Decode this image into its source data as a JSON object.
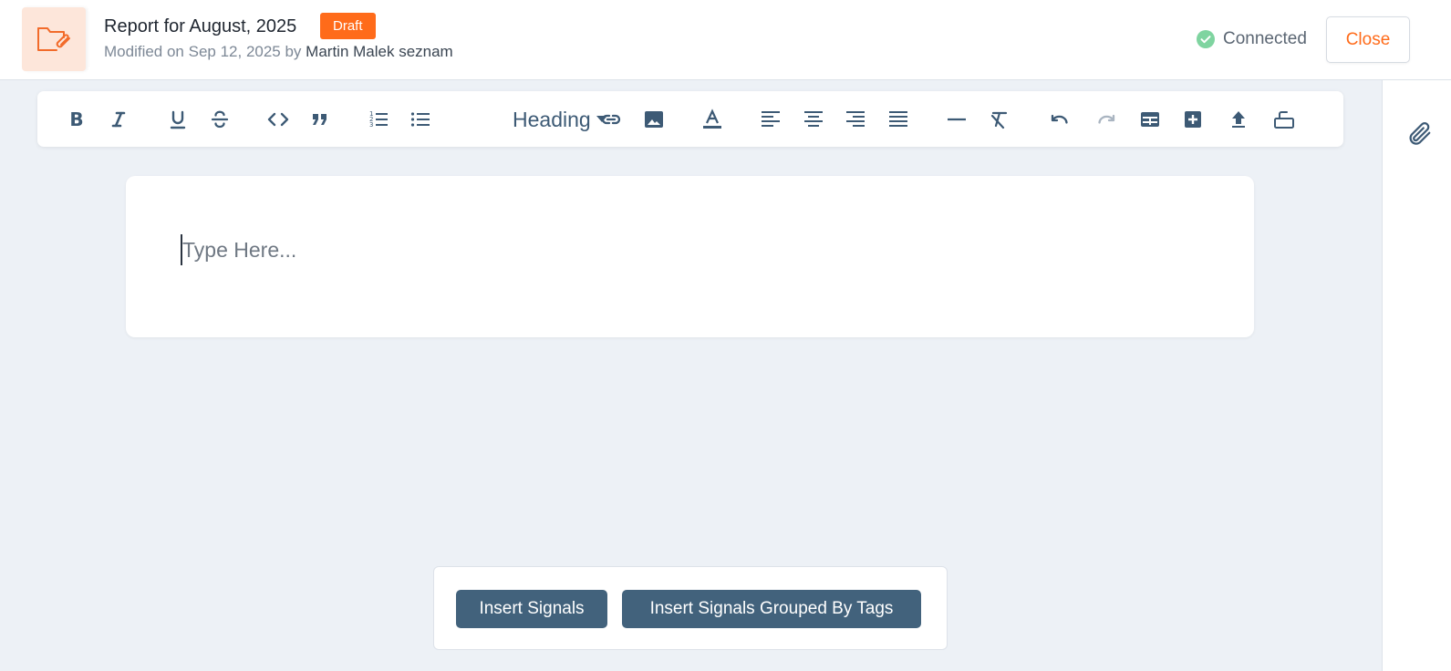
{
  "header": {
    "title": "Report for August, 2025",
    "badge": "Draft",
    "modified_prefix": "Modified on Sep 12, 2025 by",
    "author": "Martin Malek seznam",
    "status": "Connected",
    "close_label": "Close"
  },
  "toolbar": {
    "heading_label": "Heading",
    "items": [
      "bold",
      "italic",
      "underline",
      "strikethrough",
      "code",
      "blockquote",
      "ordered-list",
      "bullet-list",
      "heading",
      "link",
      "image",
      "text-color",
      "align-left",
      "align-center",
      "align-right",
      "align-justify",
      "horizontal-rule",
      "clear-format",
      "undo",
      "redo",
      "table",
      "insert-block",
      "upload",
      "toggle-panel"
    ]
  },
  "editor": {
    "placeholder": "Type Here..."
  },
  "insert_bar": {
    "insert_signals": "Insert Signals",
    "insert_grouped": "Insert Signals Grouped By Tags"
  },
  "colors": {
    "accent": "#ff6b1a",
    "toolbar_icon": "#3d5a75",
    "button_bg": "#42627c",
    "connected": "#7fd4a0"
  }
}
